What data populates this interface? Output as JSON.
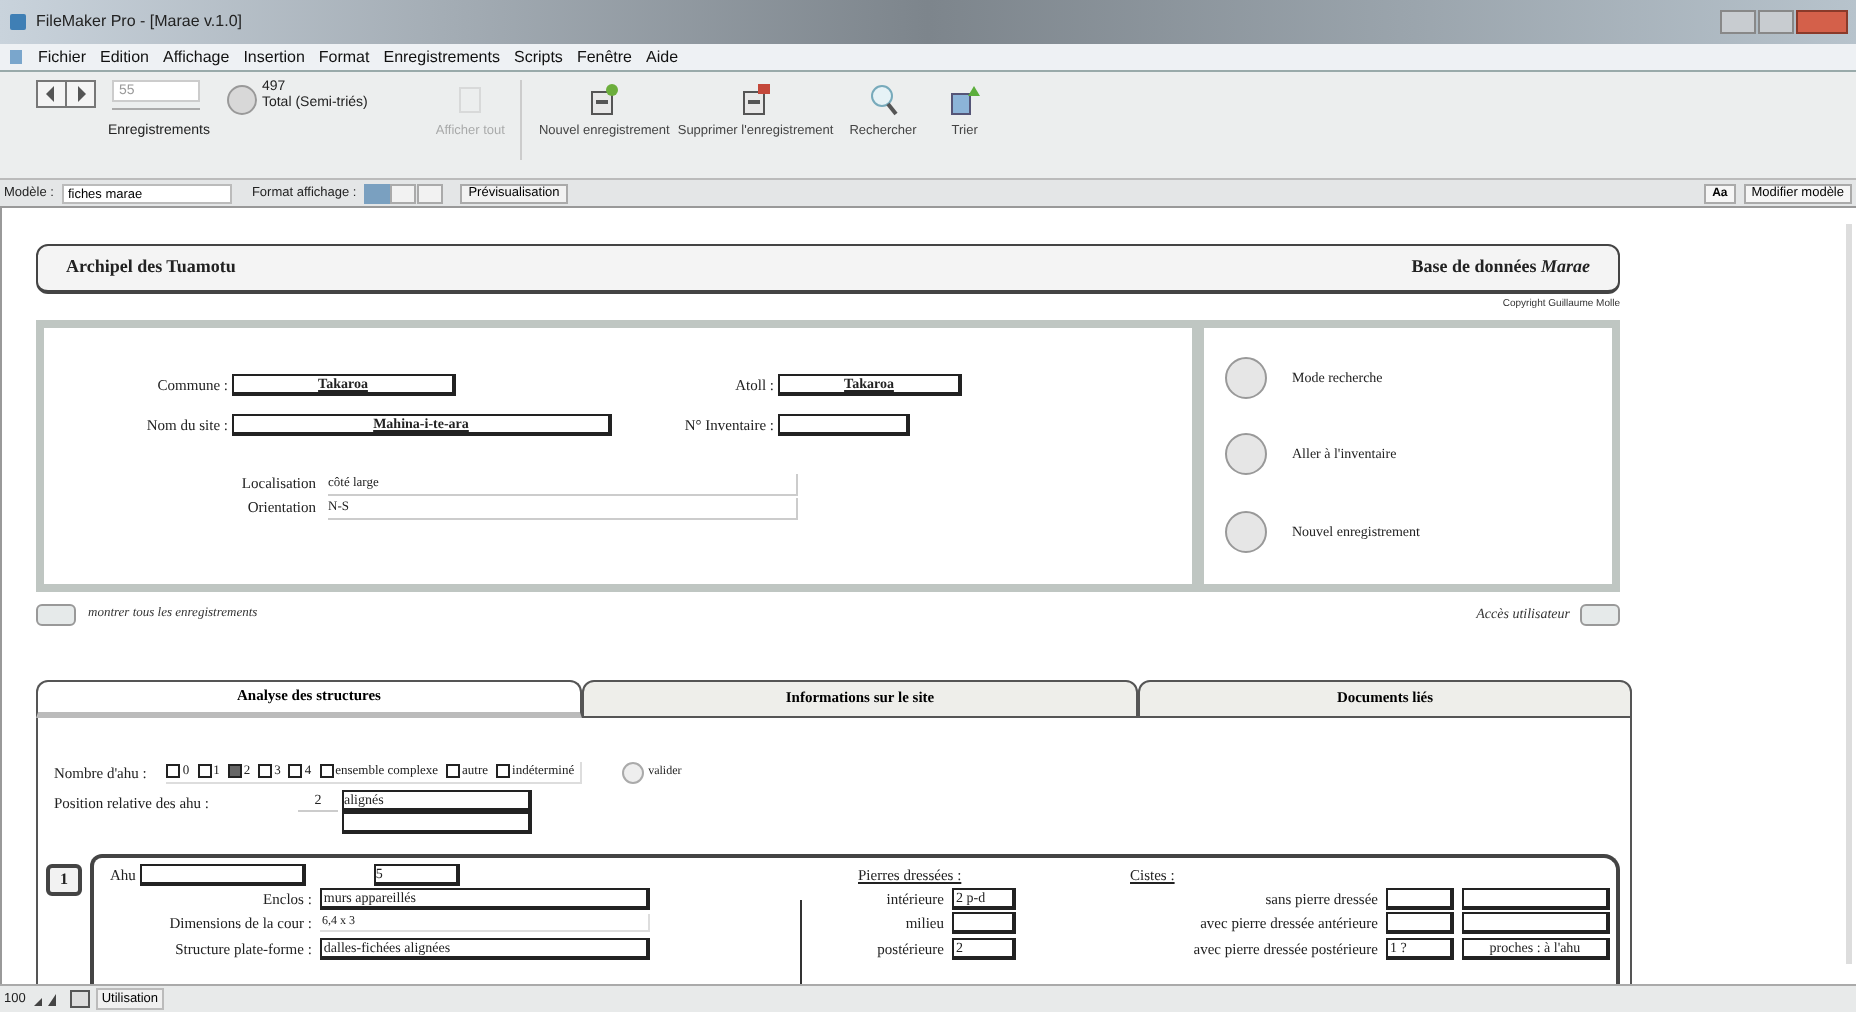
{
  "window": {
    "title": "FileMaker Pro - [Marae v.1.0]"
  },
  "menu": [
    "Fichier",
    "Edition",
    "Affichage",
    "Insertion",
    "Format",
    "Enregistrements",
    "Scripts",
    "Fenêtre",
    "Aide"
  ],
  "toolbar": {
    "record": "55",
    "found": "497",
    "total_label": "Total (Semi-triés)",
    "records_label": "Enregistrements",
    "buttons": [
      {
        "kind": "show_all",
        "label": "Afficher tout",
        "disabled": true
      },
      {
        "kind": "new",
        "label": "Nouvel enregistrement",
        "disabled": false
      },
      {
        "kind": "delete",
        "label": "Supprimer l'enregistrement",
        "disabled": false
      },
      {
        "kind": "find",
        "label": "Rechercher",
        "disabled": false
      },
      {
        "kind": "sort",
        "label": "Trier",
        "disabled": false
      }
    ]
  },
  "layout_bar": {
    "layout_label": "Modèle :",
    "layout": "fiches marae",
    "view_label": "Format affichage :",
    "preview": "Prévisualisation",
    "font_button": "Aa",
    "edit_layout": "Modifier modèle"
  },
  "header": {
    "title": "Archipel des Tuamotu",
    "subtitle": "Base de données *Marae*",
    "copyright": "Copyright Guillaume Molle"
  },
  "site": {
    "commune_label": "Commune :",
    "commune": "Takaroa",
    "atoll_label": "Atoll :",
    "atoll": "Takaroa",
    "name_label": "Nom du site :",
    "name": "Mahina-i-te-ara",
    "inventory_label": "N° Inventaire :",
    "location_label": "Localisation",
    "location": "côté large",
    "orientation_label": "Orientation",
    "orientation": "N-S"
  },
  "actions": [
    "Mode recherche",
    "Aller à l'inventaire",
    "Nouvel enregistrement"
  ],
  "show_all": "montrer tous les enregistrements",
  "user_access": "Accès utilisateur",
  "tabs": [
    {
      "label": "Analyse des structures",
      "selected": true
    },
    {
      "label": "Informations sur le site",
      "selected": false
    },
    {
      "label": "Documents liés",
      "selected": false
    }
  ],
  "ahu_count": {
    "label": "Nombre d'ahu :",
    "options": [
      {
        "label": "0",
        "checked": false
      },
      {
        "label": "1",
        "checked": false
      },
      {
        "label": "2",
        "checked": true
      },
      {
        "label": "3",
        "checked": false
      },
      {
        "label": "4",
        "checked": false
      },
      {
        "label": "ensemble complexe",
        "checked": false
      },
      {
        "label": "autre",
        "checked": false
      },
      {
        "label": "indéterminé",
        "checked": false
      }
    ],
    "validate": "valider"
  },
  "position": {
    "label": "Position relative des ahu :",
    "number": "2",
    "value": "alignés"
  },
  "structure": {
    "number": "1",
    "ahu_label": "Ahu",
    "ahu_code": "5",
    "enclosure_label": "Enclos :",
    "enclosure": "murs appareillés",
    "court_label": "Dimensions de la cour :",
    "court": "6,4 x 3",
    "platform_label": "Structure plate-forme :",
    "platform": "dalles-fichées alignées",
    "stones_title": "Pierres dressées :",
    "stones": [
      {
        "label": "intérieure",
        "value": "2 p-d"
      },
      {
        "label": "milieu"
      },
      {
        "label": "postérieure",
        "value": "2"
      }
    ],
    "cists_title": "Cistes :",
    "cists": [
      {
        "label": "sans pierre dressée"
      },
      {
        "label": "avec pierre dressée antérieure"
      },
      {
        "label": "avec pierre dressée postérieure",
        "value": "1 ?",
        "note": "proches : à l'ahu"
      }
    ]
  },
  "status_bar": {
    "zoom": "100",
    "mode": "Utilisation"
  }
}
